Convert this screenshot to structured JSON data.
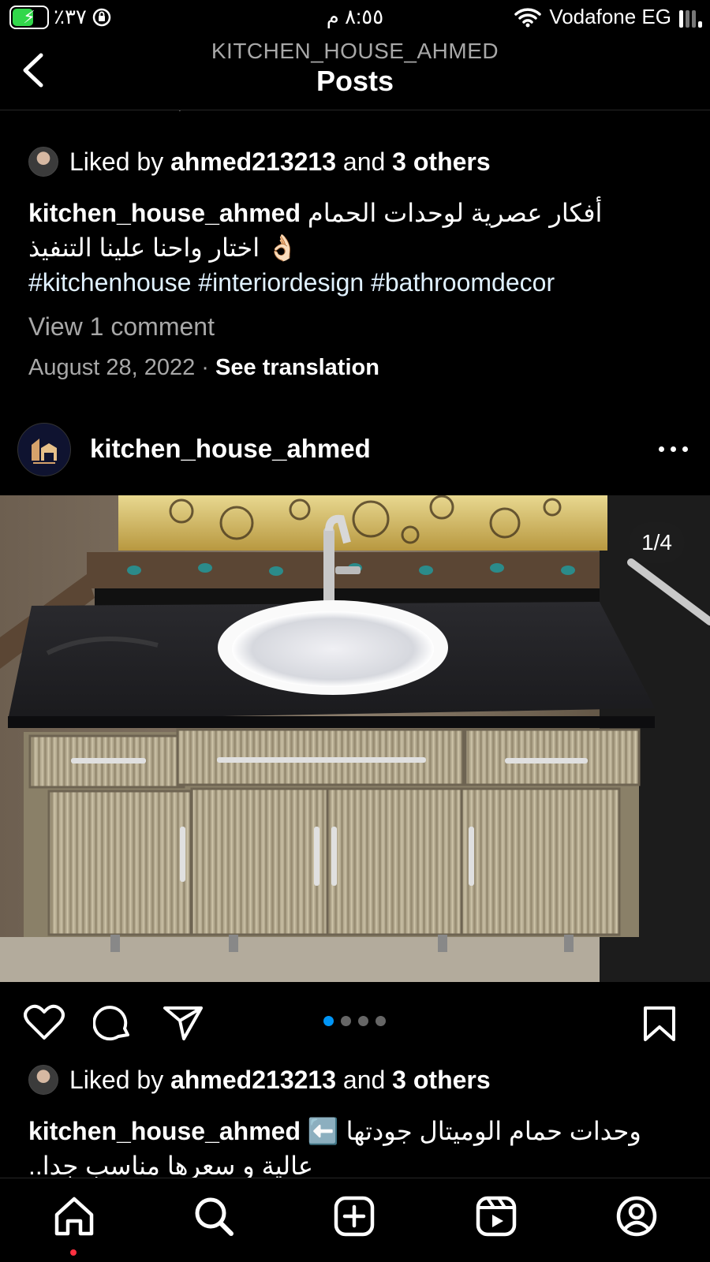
{
  "status_bar": {
    "battery": "٪٣٧",
    "time": "٨:٥٥ م",
    "carrier": "Vodafone EG"
  },
  "header": {
    "subtitle": "KITCHEN_HOUSE_AHMED",
    "title": "Posts"
  },
  "previous_post": {
    "liked_prefix": "Liked by",
    "liked_user": "ahmed213213",
    "liked_and": "and",
    "liked_others": "3 others",
    "caption_user": "kitchen_house_ahmed",
    "caption_line1": "أفكار عصرية لوحدات الحمام",
    "caption_line2": "اختار واحنا علينا التنفيذ",
    "caption_emoji": "👌🏻",
    "hashtags": "#kitchenhouse #interiordesign #bathroomdecor",
    "view_comments": "View 1 comment",
    "date": "August 28, 2022",
    "separator": "·",
    "see_translation": "See translation"
  },
  "post": {
    "username": "kitchen_house_ahmed",
    "image_counter": "1/4",
    "carousel_index": 0,
    "carousel_count": 4,
    "liked_prefix": "Liked by",
    "liked_user": "ahmed213213",
    "liked_and": "and",
    "liked_others": "3 others",
    "caption_user": "kitchen_house_ahmed",
    "caption_emoji": "⬅️",
    "caption_line1": "وحدات حمام الوميتال جودتها",
    "caption_line2": "عالية و سعرها مناسب جدا.."
  },
  "icons": {
    "back": "chevron-left-icon",
    "like": "heart-icon",
    "comment": "comment-icon",
    "share": "send-icon",
    "save": "bookmark-icon",
    "more": "more-horizontal-icon",
    "nav": [
      "home-icon",
      "search-icon",
      "create-icon",
      "reels-icon",
      "profile-icon"
    ]
  },
  "colors": {
    "background": "#000000",
    "link_blue": "#0095f6",
    "muted": "#a8a8a8",
    "notification": "#ff3040",
    "battery": "#32d74b"
  }
}
